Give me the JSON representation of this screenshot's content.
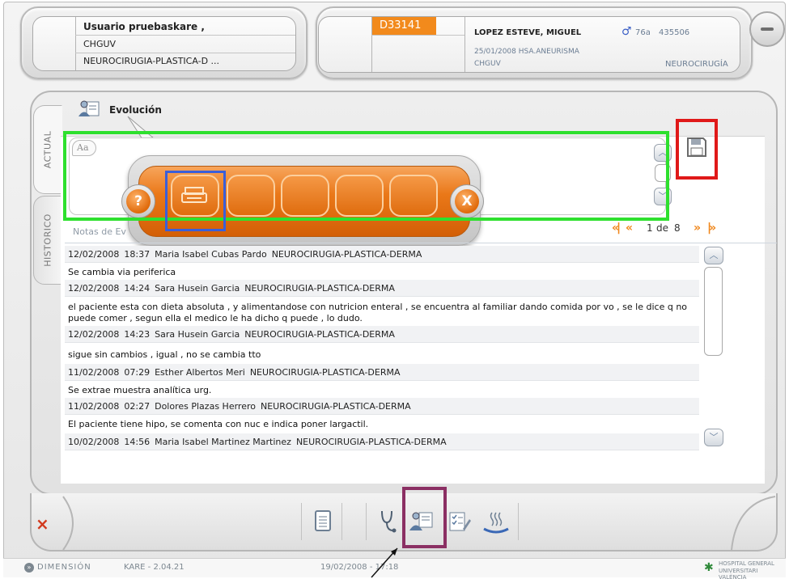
{
  "user": {
    "name": "Usuario pruebaskare ,",
    "center": "CHGUV",
    "service": "NEUROCIRUGIA-PLASTICA-D ..."
  },
  "patient": {
    "case_id": "D33141",
    "name": "LOPEZ ESTEVE, MIGUEL",
    "sex_icon": "male-symbol-icon",
    "age": "76a",
    "history_number": "435506",
    "admission": "25/01/2008  HSA.ANEURISMA",
    "center": "CHGUV",
    "department": "NEUROCIRUGÍA"
  },
  "tabs": {
    "actual": "ACTUAL",
    "historico": "HISTORICO"
  },
  "section": {
    "title": "Evolución",
    "icon": "doctor-notes-icon"
  },
  "editor": {
    "font_tag": "Aa",
    "save_icon": "floppy-disk-icon"
  },
  "popup": {
    "help_label": "?",
    "close_label": "X",
    "slots": [
      "printer",
      "",
      "",
      "",
      ""
    ],
    "print_icon": "printer-icon"
  },
  "notes": {
    "label": "Notas de Ev",
    "pager": {
      "current": "1",
      "of_label": "de",
      "total": "8"
    },
    "entries": [
      {
        "date": "12/02/2008",
        "time": "18:37",
        "author": "Maria Isabel Cubas Pardo",
        "service": "NEUROCIRUGIA-PLASTICA-DERMA",
        "text": "Se cambia via periferica"
      },
      {
        "date": "12/02/2008",
        "time": "14:24",
        "author": "Sara Husein Garcia",
        "service": "NEUROCIRUGIA-PLASTICA-DERMA",
        "text": "el paciente esta con dieta absoluta , y alimentandose con nutricion enteral , se encuentra al familiar dando comida por vo , se le dice q no puede comer , segun ella el medico le ha dicho q puede , lo dudo."
      },
      {
        "date": "12/02/2008",
        "time": "14:23",
        "author": "Sara Husein Garcia",
        "service": "NEUROCIRUGIA-PLASTICA-DERMA",
        "text": "sigue sin cambios , igual , no se cambia tto"
      },
      {
        "date": "11/02/2008",
        "time": "07:29",
        "author": "Esther Albertos Meri",
        "service": "NEUROCIRUGIA-PLASTICA-DERMA",
        "text": "Se extrae muestra analítica urg."
      },
      {
        "date": "11/02/2008",
        "time": "02:27",
        "author": "Dolores Plazas Herrero",
        "service": "NEUROCIRUGIA-PLASTICA-DERMA",
        "text": "El paciente tiene hipo, se comenta con nuc e indica poner largactil."
      },
      {
        "date": "10/02/2008",
        "time": "14:56",
        "author": "Maria Isabel Martinez Martinez",
        "service": "NEUROCIRUGIA-PLASTICA-DERMA",
        "text": ""
      }
    ]
  },
  "toolbar": {
    "close_label": "×",
    "buttons": [
      "clipboard-list-icon",
      "stethoscope-icon",
      "doctor-notes-icon",
      "checklist-edit-icon",
      "heat-bath-icon"
    ]
  },
  "status": {
    "brand": "DIMENSIÓN",
    "version": "KARE - 2.04.21",
    "datetime": "19/02/2008 - 17:18",
    "hospital_line1": "HOSPITAL GENERAL",
    "hospital_line2": "UNIVERSITARI VALÈNCIA"
  },
  "colors": {
    "accent_orange": "#ea7818",
    "highlight_green": "#2ee02e",
    "highlight_red": "#e01919",
    "highlight_blue": "#3a5fd9",
    "highlight_purple": "#8b2f63"
  }
}
